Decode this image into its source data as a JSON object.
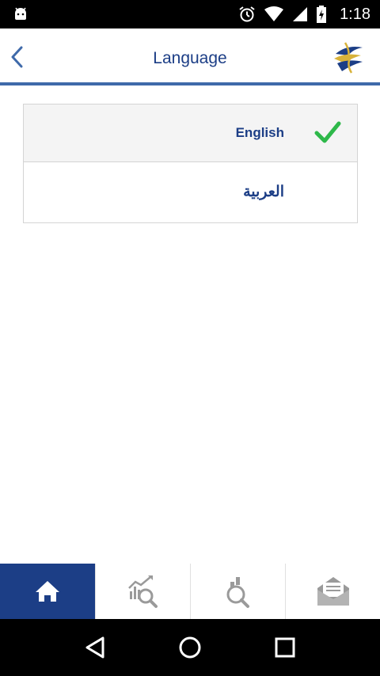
{
  "status_bar": {
    "time": "1:18",
    "icons": [
      "android-icon",
      "alarm-icon",
      "wifi-icon",
      "signal-icon",
      "battery-icon"
    ]
  },
  "header": {
    "title": "Language",
    "back_icon": "chevron-left-icon",
    "logo": "bank-logo"
  },
  "languages": [
    {
      "label": "English",
      "selected": true
    },
    {
      "label": "العربية",
      "selected": false
    }
  ],
  "bottom_nav": {
    "tabs": [
      {
        "icon": "home-icon",
        "active": true
      },
      {
        "icon": "chart-search-icon",
        "active": false
      },
      {
        "icon": "money-search-icon",
        "active": false
      },
      {
        "icon": "mail-icon",
        "active": false
      }
    ]
  },
  "colors": {
    "brand_blue": "#1c3e86",
    "header_divider": "#3f6aaa",
    "check_green": "#2eb84a",
    "status_bar": "#000000"
  }
}
